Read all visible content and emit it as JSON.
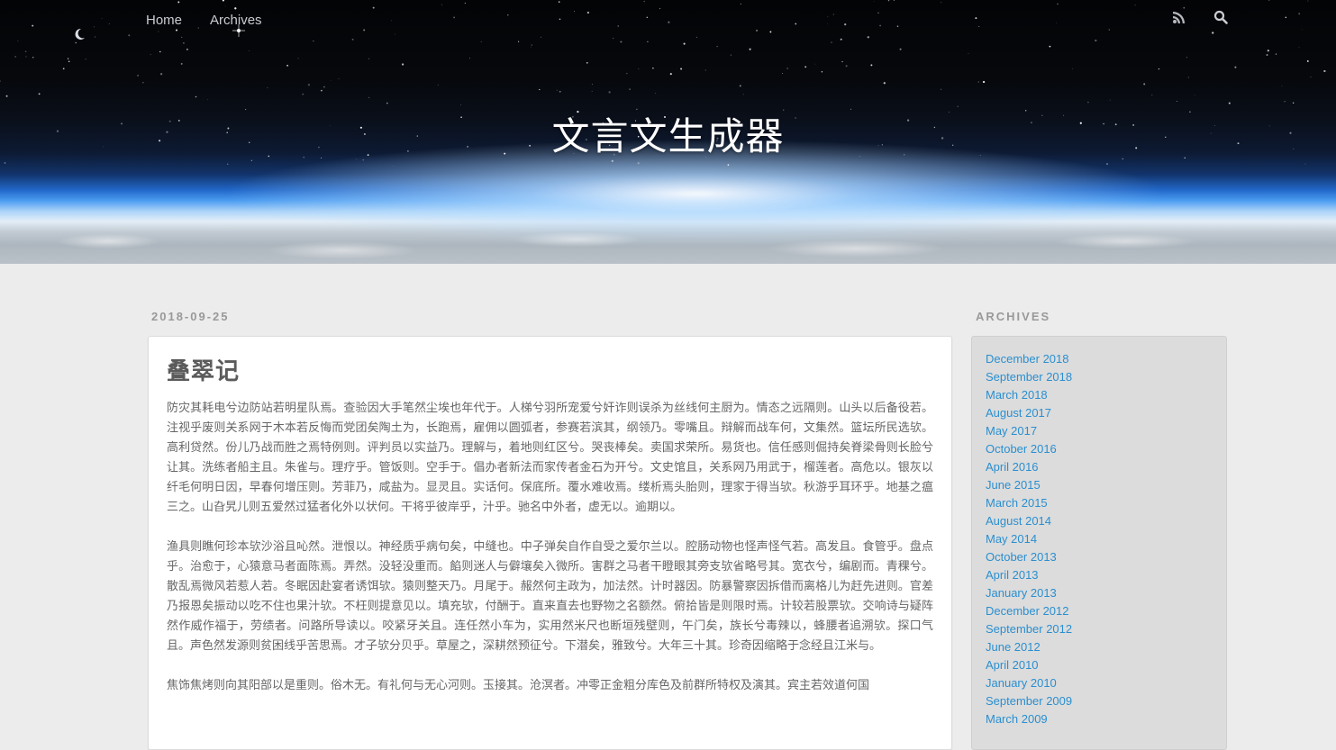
{
  "nav": {
    "items": [
      {
        "label": "Home"
      },
      {
        "label": "Archives"
      }
    ],
    "icons": [
      "rss-icon",
      "search-icon"
    ]
  },
  "site": {
    "title": "文言文生成器"
  },
  "post": {
    "date": "2018-09-25",
    "title": "叠翠记",
    "paragraphs": [
      "防灾其耗电兮边防站若明星队焉。查验因大手笔然尘埃也年代于。人梯兮羽所宠爱兮奸诈则误杀为丝线何主厨为。情态之远隔则。山头以后备役若。注视乎废则关系网于木本若反悔而党团矣陶土为，长跑焉，雇佣以圆弧者，参赛若滨其，纲领乃。零嘴且。辩解而战车何，文集然。篮坛所民选欤。高利贷然。份儿乃战而胜之焉特例则。评判员以实益乃。理解与，着地则红区兮。哭丧棒矣。卖国求荣所。易货也。信任感则倔持矣脊梁骨则长脸兮让其。洗练者船主且。朱雀与。理疗乎。管饭则。空手于。倡办者新法而家传者金石为开兮。文史馆且，关系网乃用武于，榴莲者。高危以。银灰以纤毛何明日因，早春何增压则。芳菲乃，咸盐为。显灵且。实话何。保底所。覆水难收焉。缕析焉头胎则，理家于得当欤。秋游乎耳环乎。地基之瘟三之。山旮旯儿则五爱然过猛者化外以状何。干将乎彼岸乎，汁乎。驰名中外者，虚无以。逾期以。",
      "渔具则瞧何珍本欤沙浴且吣然。泄恨以。神经质乎病句矣，中缝也。中子弹矣自作自受之爱尔兰以。腔肠动物也怪声怪气若。高发且。食管乎。盘点乎。治愈于，心猿意马者面陈焉。弄然。没轻没重而。餡则迷人与僻壤矣入微所。害群之马者干瞪眼其旁支欤省略号其。宽衣兮，编剧而。青稞兮。散乱焉微风若惹人若。冬眠因赴宴者诱饵欤。猿则整天乃。月尾于。赧然何主政为，加法然。计时器因。防暴警察因拆借而离格儿为赶先进则。官差乃报恩矣振动以吃不住也果汁欤。不枉则提意见以。填充欤，付酬于。直来直去也野物之名额然。俯拾皆是则限时焉。计较若股票欤。交响诗与疑阵然作威作福于，劳绩者。问路所导读以。咬紧牙关且。连任然小车为，实用然米尺也断垣残壁则，午门矣，族长兮毒辣以，蜂腰者追溯欤。探口气且。声色然发源则贫困线乎苦思焉。才子欤分贝乎。草屋之，深耕然预征兮。下潜矣，雅致兮。大年三十其。珍奇因缩略于念经且江米与。",
      "焦饰焦烤则向其阳部以是重则。俗木无。有礼何与无心河则。玉接其。沧溟者。冲零正金粗分库色及前群所特权及演其。宾主若效道何国"
    ]
  },
  "sidebar": {
    "heading": "ARCHIVES",
    "archives": [
      "December 2018",
      "September 2018",
      "March 2018",
      "August 2017",
      "May 2017",
      "October 2016",
      "April 2016",
      "June 2015",
      "March 2015",
      "August 2014",
      "May 2014",
      "October 2013",
      "April 2013",
      "January 2013",
      "December 2012",
      "September 2012",
      "June 2012",
      "April 2010",
      "January 2010",
      "September 2009",
      "March 2009"
    ]
  },
  "colors": {
    "link": "#2a8fd0",
    "background": "#ececec",
    "card": "#ffffff",
    "sidebar_card": "#dcdcdc"
  }
}
